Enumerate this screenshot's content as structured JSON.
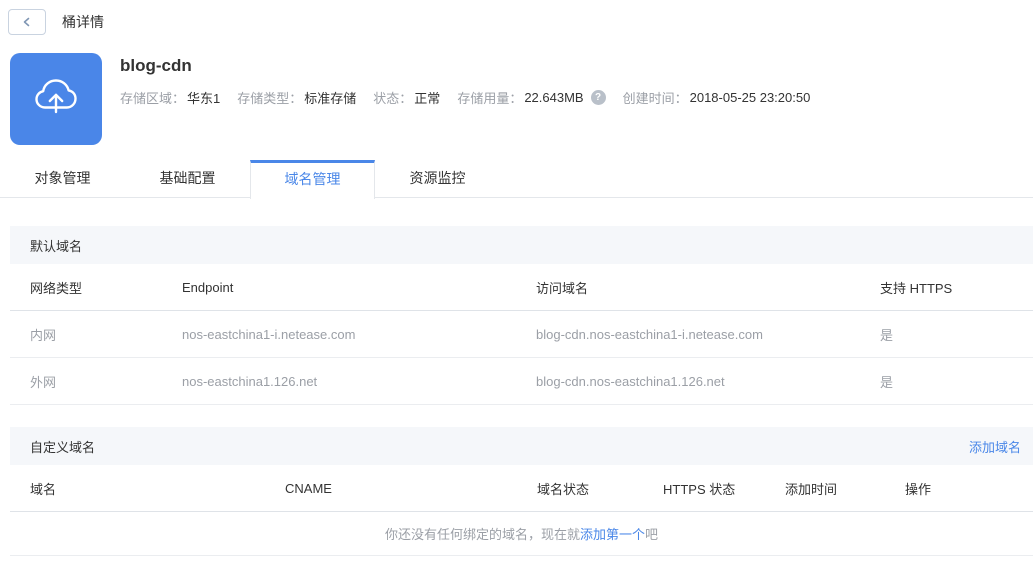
{
  "topbar": {
    "title": "桶详情"
  },
  "bucket": {
    "name": "blog-cdn",
    "usage_help_glyph": "?",
    "info": [
      {
        "label": "存储区域：",
        "value": "华东1"
      },
      {
        "label": "存储类型：",
        "value": "标准存储"
      },
      {
        "label": "状态：",
        "value": "正常"
      },
      {
        "label": "存储用量：",
        "value": "22.643MB"
      },
      {
        "label": "创建时间：",
        "value": "2018-05-25 23:20:50"
      }
    ]
  },
  "tabs": [
    {
      "label": "对象管理"
    },
    {
      "label": "基础配置"
    },
    {
      "label": "域名管理"
    },
    {
      "label": "资源监控"
    }
  ],
  "active_tab": "域名管理",
  "default_domains": {
    "section_title": "默认域名",
    "columns": [
      "网络类型",
      "Endpoint",
      "访问域名",
      "支持 HTTPS"
    ],
    "rows": [
      {
        "network_type": "内网",
        "endpoint": "nos-eastchina1-i.netease.com",
        "access_domain": "blog-cdn.nos-eastchina1-i.netease.com",
        "https_supported": "是"
      },
      {
        "network_type": "外网",
        "endpoint": "nos-eastchina1.126.net",
        "access_domain": "blog-cdn.nos-eastchina1.126.net",
        "https_supported": "是"
      }
    ]
  },
  "custom_domains": {
    "section_title": "自定义域名",
    "add_button": "添加域名",
    "columns": [
      "域名",
      "CNAME",
      "域名状态",
      "HTTPS 状态",
      "添加时间",
      "操作"
    ],
    "empty_prefix": "你还没有任何绑定的域名，现在就",
    "empty_link": "添加第一个",
    "empty_suffix": "吧"
  },
  "colors": {
    "accent": "#4a87e8",
    "icon_bg": "#4a86e8",
    "section_bg": "#f5f7fa",
    "text_dark": "#333333",
    "text_gray": "#9b9fa6",
    "row_border": "#ebedf0"
  }
}
